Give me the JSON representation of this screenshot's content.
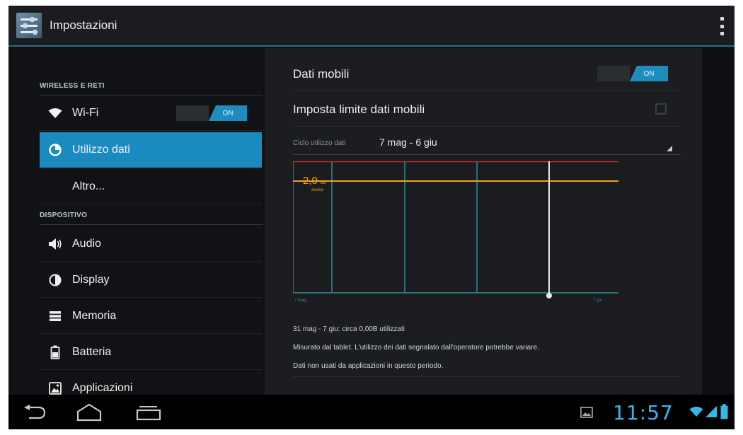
{
  "action_bar": {
    "title": "Impostazioni",
    "app_icon": "settings-app-icon",
    "overflow_icon": "overflow-menu-icon"
  },
  "sidebar": {
    "sections": [
      {
        "header": "WIRELESS E RETI"
      },
      {
        "header": "DISPOSITIVO"
      }
    ],
    "items": [
      {
        "label": "Wi-Fi",
        "icon": "wifi-icon",
        "toggle": "ON"
      },
      {
        "label": "Utilizzo dati",
        "icon": "data-usage-icon",
        "selected": true
      },
      {
        "label": "Altro..."
      },
      {
        "label": "Audio",
        "icon": "speaker-icon"
      },
      {
        "label": "Display",
        "icon": "display-icon"
      },
      {
        "label": "Memoria",
        "icon": "storage-icon"
      },
      {
        "label": "Batteria",
        "icon": "battery-icon"
      },
      {
        "label": "Applicazioni",
        "icon": "apps-icon"
      }
    ]
  },
  "main": {
    "mobile_data": {
      "label": "Dati mobili",
      "toggle": "ON"
    },
    "limit": {
      "label": "Imposta limite dati mobili",
      "checked": false
    },
    "cycle": {
      "label": "Ciclo utilizzo dati",
      "value": "7 mag - 6 giu"
    },
    "chart": {
      "warning_value": "2,0",
      "warning_unit": "GB",
      "warning_label": "avviso",
      "start_label": "7 mag",
      "end_label": "7 giu"
    },
    "summary": "31 mag - 7 giu: circa 0,00B utilizzati",
    "note1": "Misurato dal tablet. L'utilizzo dei dati segnalato dall'operatore potrebbe variare.",
    "note2": "Dati non usati da applicazioni in questo periodo."
  },
  "system_bar": {
    "clock": "11:57",
    "back_icon": "back-icon",
    "home_icon": "home-icon",
    "recents_icon": "recent-apps-icon",
    "screenshot_icon": "screenshot-notification-icon",
    "wifi_icon": "wifi-status-icon",
    "signal_icon": "signal-icon",
    "battery_icon": "battery-status-icon"
  },
  "colors": {
    "accent": "#1a8ac1",
    "limit_line": "#d32a2a",
    "warning_line": "#f0a21c",
    "cycle_line": "#2f8d92",
    "clock": "#35b9ea"
  }
}
